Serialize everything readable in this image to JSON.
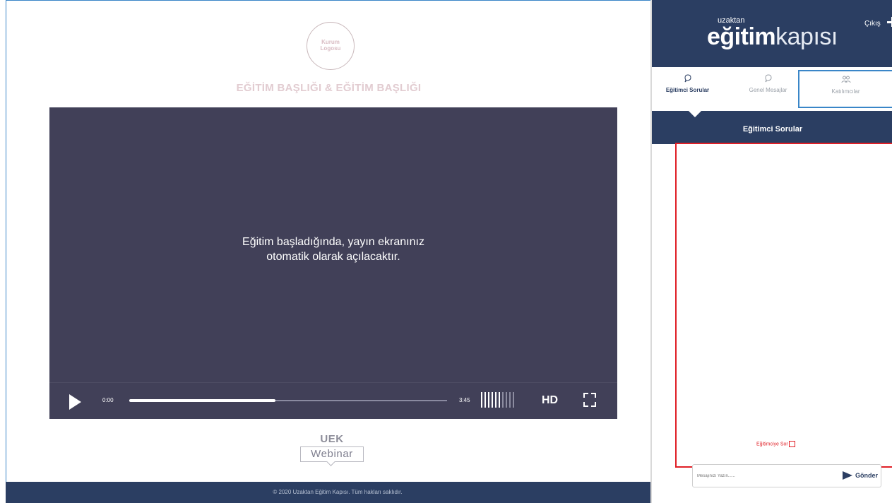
{
  "main": {
    "logo_line1": "Kurum",
    "logo_line2": "Logosu",
    "title": "EĞİTİM BAŞLIĞI & EĞİTİM BAŞLIĞI",
    "video_message_line1": "Eğitim başladığında, yayın ekranınız",
    "video_message_line2": "otomatik olarak açılacaktır.",
    "player": {
      "current_time": "0:00",
      "duration": "3:45",
      "progress_fraction": 0.46,
      "volume_level": 0.6,
      "quality_label": "HD",
      "play_icon": "play-icon",
      "fullscreen_icon": "fullscreen-icon"
    },
    "brand": {
      "uek": "UEK",
      "webinar": "Webinar"
    }
  },
  "footer": {
    "copyright": "© 2020 Uzaktan Eğitim Kapısı. Tüm hakları saklıdır."
  },
  "sidebar": {
    "brand_small": "uzaktan",
    "brand_big_bold": "eğitim",
    "brand_big_light": "kapısı",
    "exit_label": "Çıkış",
    "tabs": [
      {
        "label": "Eğitimci Sorular",
        "icon": "chat-icon"
      },
      {
        "label": "Genel Mesajlar",
        "icon": "chat-icon"
      },
      {
        "label": "Katılımcılar",
        "icon": "users-icon"
      }
    ],
    "active_tab_title": "Eğitimci Sorular",
    "ask_label": "Eğitimciye Sor",
    "message_placeholder": "Mesajınızı Yazın......",
    "send_label": "Gönder",
    "colors": {
      "navy": "#2b3e62",
      "highlight_red": "#e01f26",
      "highlight_blue": "#3a86c8"
    }
  }
}
